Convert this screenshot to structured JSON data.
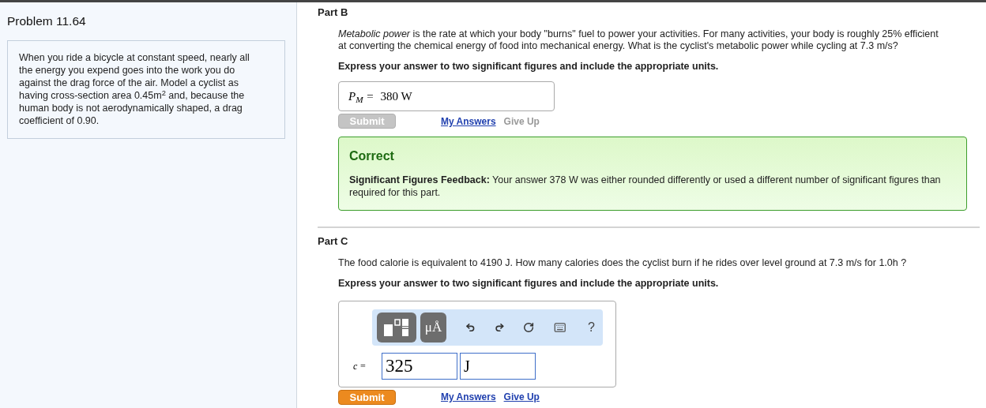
{
  "problem": {
    "title": "Problem 11.64",
    "text": "When you ride a bicycle at constant speed, nearly all the energy you expend goes into the work you do against the drag force of the air. Model a cyclist as having cross-section area 0.45m$^{2}$ and, because the human body is not aerodynamically shaped, a drag coefficient of 0.90."
  },
  "parts": [
    {
      "title": "Part B",
      "question": "*Metabolic power* is the rate at which your body \"burns\" fuel to power your activities. For many activities, your body is roughly 25% efficient at converting the chemical energy of food into mechanical energy. What is the cyclist's metabolic power while cycling at 7.3 m/s?",
      "instruction": "Express your answer to two significant figures and include the appropriate units.",
      "answer": {
        "kind": "simple",
        "label": "P$_{M}$ =",
        "value": "380 W"
      },
      "submit": {
        "label": "Submit",
        "disabled": true
      },
      "links": [
        {
          "label": "My Answers",
          "disabled": false
        },
        {
          "label": "Give Up",
          "disabled": true
        }
      ],
      "feedback": {
        "title": "Correct",
        "text": "**Significant Figures Feedback:** Your answer 378 W was either rounded differently or used a different number of significant figures than required for this part."
      }
    },
    {
      "title": "Part C",
      "question": "The food calorie is equivalent to 4190 J. How many calories does the cyclist burn if he rides over level ground at 7.3 m/s for 1.0h ?",
      "instruction": "Express your answer to two significant figures and include the appropriate units.",
      "answer": {
        "kind": "editor",
        "label": "c =",
        "toolbar": [
          {
            "kind": "templates"
          },
          {
            "kind": "symbols",
            "label": "μÅ"
          },
          {
            "kind": "undo"
          },
          {
            "kind": "redo"
          },
          {
            "kind": "reset"
          },
          {
            "kind": "keyboard"
          },
          {
            "kind": "help",
            "label": "?"
          }
        ],
        "value": "325",
        "unit": "J"
      },
      "submit": {
        "label": "Submit",
        "disabled": false
      },
      "links": [
        {
          "label": "My Answers",
          "disabled": false
        },
        {
          "label": "Give Up",
          "disabled": false
        }
      ]
    }
  ]
}
